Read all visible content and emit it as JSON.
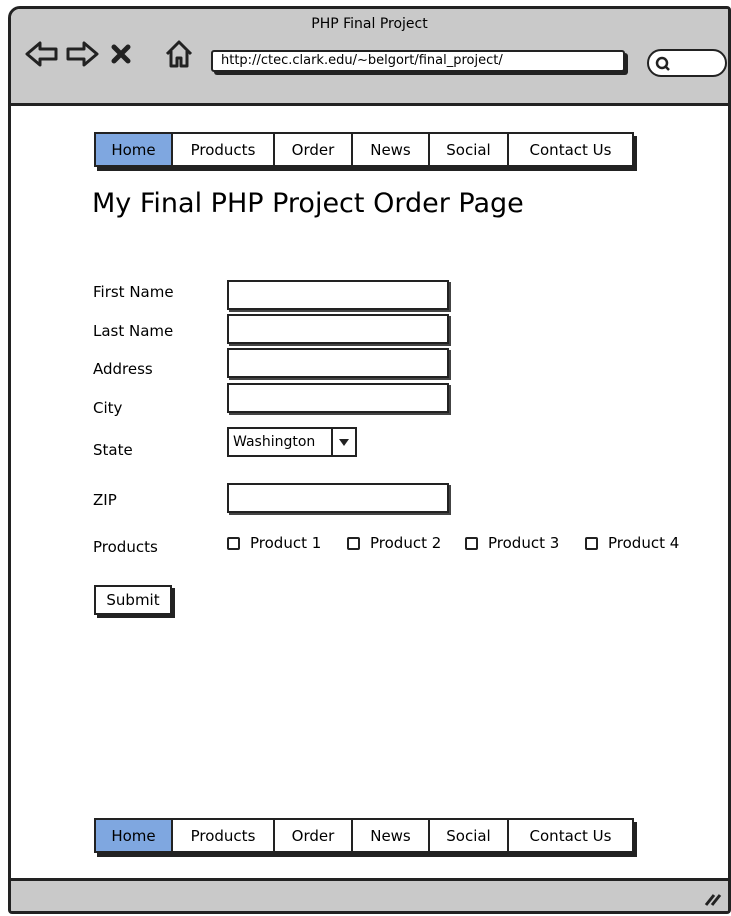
{
  "window": {
    "title": "PHP Final Project"
  },
  "browser": {
    "url": "http://ctec.clark.edu/~belgort/final_project/"
  },
  "nav": {
    "active": "Home",
    "items": [
      "Home",
      "Products",
      "Order",
      "News",
      "Social",
      "Contact Us"
    ]
  },
  "page": {
    "title": "My Final PHP Project Order Page"
  },
  "form": {
    "labels": {
      "first_name": "First Name",
      "last_name": "Last Name",
      "address": "Address",
      "city": "City",
      "state": "State",
      "zip": "ZIP",
      "products": "Products"
    },
    "values": {
      "first_name": "",
      "last_name": "",
      "address": "",
      "city": "",
      "zip": ""
    },
    "state_selected": "Washington",
    "products": [
      {
        "label": "Product 1",
        "checked": false
      },
      {
        "label": "Product 2",
        "checked": false
      },
      {
        "label": "Product 3",
        "checked": false
      },
      {
        "label": "Product 4",
        "checked": false
      }
    ],
    "submit_label": "Submit"
  },
  "colors": {
    "accent": "#7fa7e0",
    "chrome": "#c9c9c9",
    "line": "#222222"
  },
  "icons": [
    "back-arrow-icon",
    "forward-arrow-icon",
    "stop-icon",
    "home-icon",
    "search-icon",
    "resize-grip-icon"
  ]
}
